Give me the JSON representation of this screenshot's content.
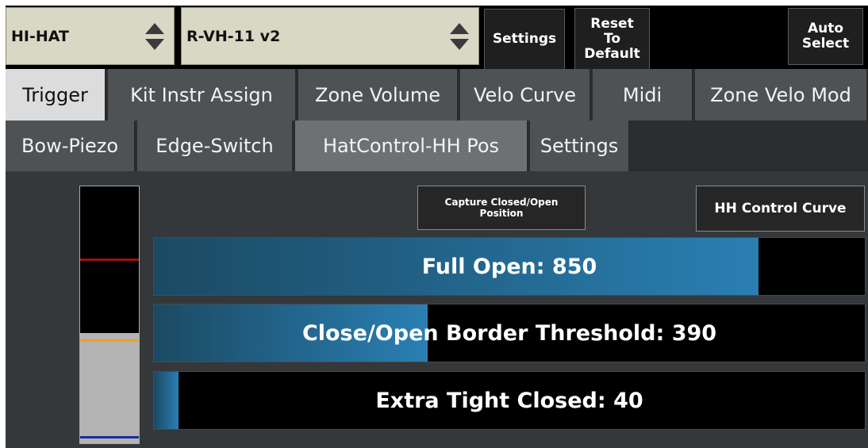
{
  "header": {
    "instrument_select": "HI-HAT",
    "pad_select": "R-VH-11 v2",
    "settings_label": "Settings",
    "reset_label_lines": [
      "Reset",
      "To",
      "Default"
    ],
    "auto_select_lines": [
      "Auto",
      "Select"
    ]
  },
  "tabs_primary": [
    {
      "label": "Trigger"
    },
    {
      "label": "Kit Instr Assign"
    },
    {
      "label": "Zone Volume"
    },
    {
      "label": "Velo Curve"
    },
    {
      "label": "Midi"
    },
    {
      "label": "Zone Velo Mod"
    }
  ],
  "tabs_secondary": [
    {
      "label": "Bow-Piezo"
    },
    {
      "label": "Edge-Switch"
    },
    {
      "label": "HatControl-HH Pos"
    },
    {
      "label": "Settings"
    }
  ],
  "main": {
    "capture_button_lines": [
      "Capture Closed/Open",
      "Position"
    ],
    "hh_curve_button": "HH Control Curve",
    "sliders": [
      {
        "label": "Full Open: 850",
        "fill_fraction": 0.85
      },
      {
        "label": "Close/Open Border Threshold: 390",
        "fill_fraction": 0.385
      },
      {
        "label": "Extra Tight Closed: 40",
        "fill_fraction": 0.035
      }
    ],
    "meter": {
      "level_fraction": 0.43,
      "colors": {
        "full_open": "#a01010",
        "threshold": "#f0a020",
        "closed": "#1a2aa0",
        "level": "#b4b4b4"
      }
    }
  },
  "colors": {
    "fill_dark": "#1b4a63",
    "fill_light": "#2a7fb3",
    "selector_bg": "#d8d8c5"
  }
}
